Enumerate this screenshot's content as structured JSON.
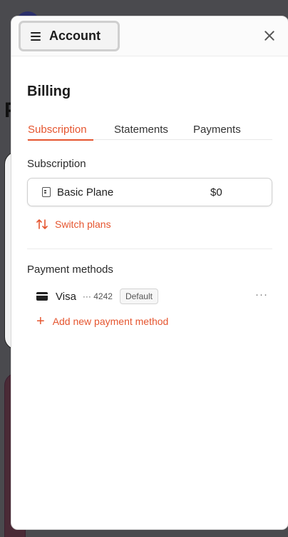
{
  "header": {
    "account_label": "Account"
  },
  "billing": {
    "title": "Billing",
    "tabs": [
      {
        "label": "Subscription",
        "active": true
      },
      {
        "label": "Statements",
        "active": false
      },
      {
        "label": "Payments",
        "active": false
      }
    ]
  },
  "subscription": {
    "label": "Subscription",
    "plan_name": "Basic Plane",
    "plan_price": "$0",
    "switch_label": "Switch plans"
  },
  "payment_methods": {
    "label": "Payment methods",
    "items": [
      {
        "brand": "Visa",
        "digits": "··· 4242",
        "badge": "Default"
      }
    ],
    "add_label": "Add new payment method"
  },
  "colors": {
    "accent": "#e5552f"
  },
  "icons": [
    "menu-icon",
    "close-icon",
    "plan-icon",
    "switch-icon",
    "card-icon",
    "more-icon",
    "plus-icon"
  ]
}
